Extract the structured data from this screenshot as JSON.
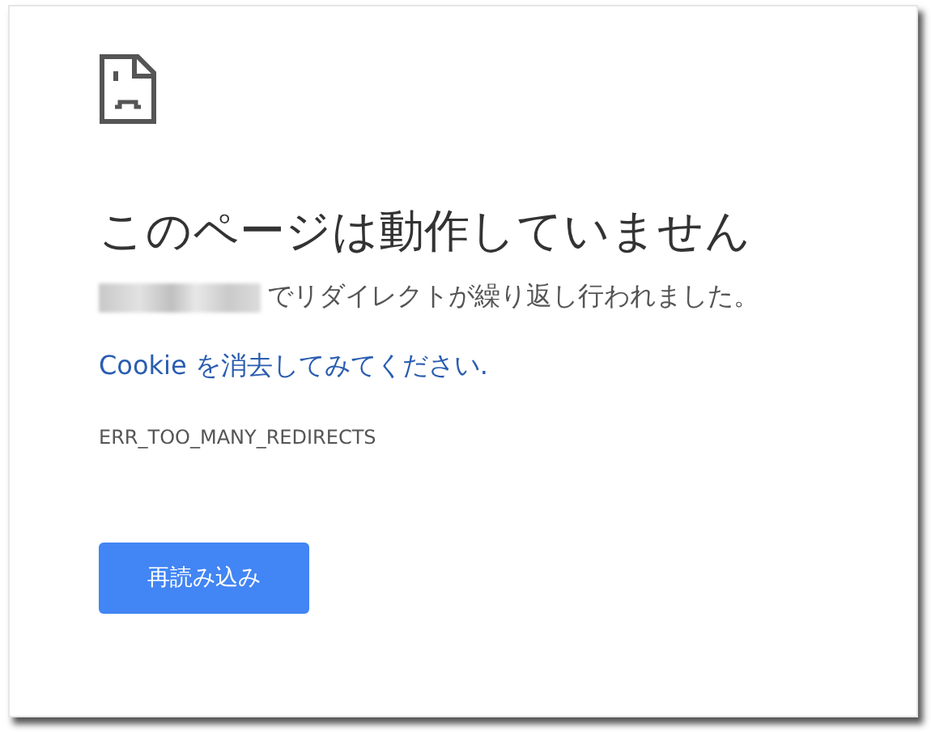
{
  "heading": "このページは動作していません",
  "message": {
    "redacted_host": true,
    "text": "でリダイレクトが繰り返し行われました。"
  },
  "suggestion_link": "Cookie を消去してみてください.",
  "error_code": "ERR_TOO_MANY_REDIRECTS",
  "reload_button": "再読み込み"
}
